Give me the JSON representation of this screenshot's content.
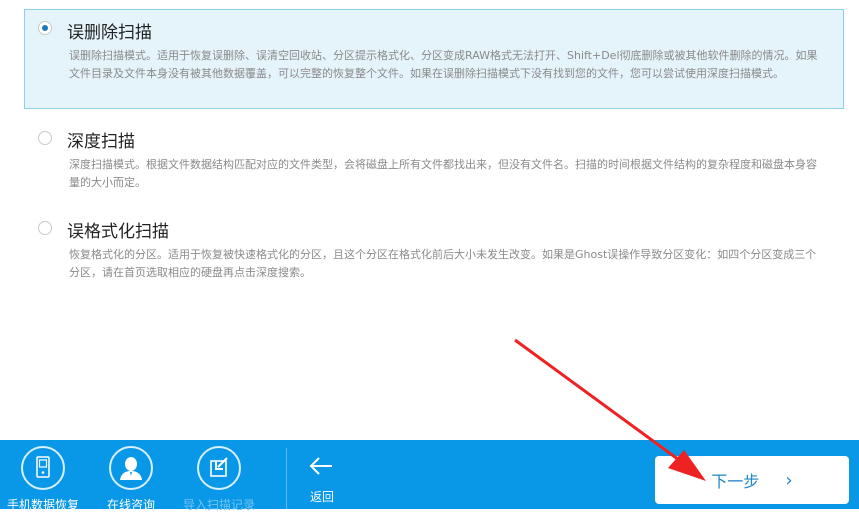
{
  "scan_modes": [
    {
      "id": "deleted-scan",
      "title": "误删除扫描",
      "selected": true,
      "description": "误删除扫描模式。适用于恢复误删除、误清空回收站、分区提示格式化、分区变成RAW格式无法打开、Shift+Del彻底删除或被其他软件删除的情况。如果文件目录及文件本身没有被其他数据覆盖，可以完整的恢复整个文件。如果在误删除扫描模式下没有找到您的文件，您可以尝试使用深度扫描模式。"
    },
    {
      "id": "deep-scan",
      "title": "深度扫描",
      "selected": false,
      "description": "深度扫描模式。根据文件数据结构匹配对应的文件类型，会将磁盘上所有文件都找出来，但没有文件名。扫描的时间根据文件结构的复杂程度和磁盘本身容量的大小而定。"
    },
    {
      "id": "format-scan",
      "title": "误格式化扫描",
      "selected": false,
      "description": "恢复格式化的分区。适用于恢复被快速格式化的分区，且这个分区在格式化前后大小未发生改变。如果是Ghost误操作导致分区变化：如四个分区变成三个分区，请在首页选取相应的硬盘再点击深度搜索。"
    }
  ],
  "bottom_bar": {
    "tools": [
      {
        "label": "手机数据恢复",
        "icon": "phone-icon",
        "enabled": true
      },
      {
        "label": "在线咨询",
        "icon": "person-icon",
        "enabled": true
      },
      {
        "label": "导入扫描记录",
        "icon": "import-icon",
        "enabled": false
      }
    ],
    "back_label": "返回",
    "next_label": "下一步",
    "next_chevron": "›"
  },
  "annotation": {
    "type": "red-arrow",
    "color": "#ee2222",
    "points_to": "next-button"
  },
  "colors": {
    "accent": "#0997e8",
    "selected_bg": "#e5f3fb",
    "selected_border": "#8fd0e6",
    "radio_dot": "#1a7ab7",
    "next_text": "#1f86c9"
  }
}
